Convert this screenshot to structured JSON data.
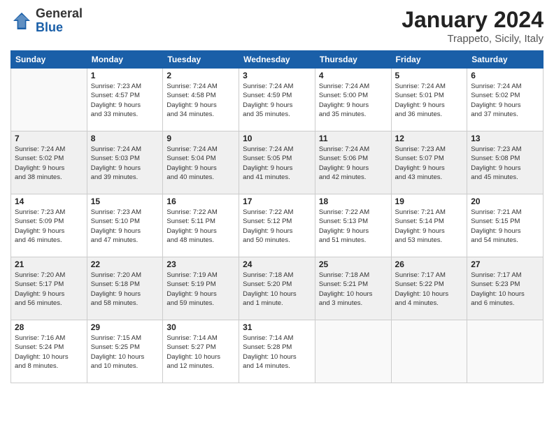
{
  "header": {
    "logo_general": "General",
    "logo_blue": "Blue",
    "title": "January 2024",
    "location": "Trappeto, Sicily, Italy"
  },
  "weekdays": [
    "Sunday",
    "Monday",
    "Tuesday",
    "Wednesday",
    "Thursday",
    "Friday",
    "Saturday"
  ],
  "weeks": [
    [
      {
        "day": "",
        "info": ""
      },
      {
        "day": "1",
        "info": "Sunrise: 7:23 AM\nSunset: 4:57 PM\nDaylight: 9 hours\nand 33 minutes."
      },
      {
        "day": "2",
        "info": "Sunrise: 7:24 AM\nSunset: 4:58 PM\nDaylight: 9 hours\nand 34 minutes."
      },
      {
        "day": "3",
        "info": "Sunrise: 7:24 AM\nSunset: 4:59 PM\nDaylight: 9 hours\nand 35 minutes."
      },
      {
        "day": "4",
        "info": "Sunrise: 7:24 AM\nSunset: 5:00 PM\nDaylight: 9 hours\nand 35 minutes."
      },
      {
        "day": "5",
        "info": "Sunrise: 7:24 AM\nSunset: 5:01 PM\nDaylight: 9 hours\nand 36 minutes."
      },
      {
        "day": "6",
        "info": "Sunrise: 7:24 AM\nSunset: 5:02 PM\nDaylight: 9 hours\nand 37 minutes."
      }
    ],
    [
      {
        "day": "7",
        "info": "Sunrise: 7:24 AM\nSunset: 5:02 PM\nDaylight: 9 hours\nand 38 minutes."
      },
      {
        "day": "8",
        "info": "Sunrise: 7:24 AM\nSunset: 5:03 PM\nDaylight: 9 hours\nand 39 minutes."
      },
      {
        "day": "9",
        "info": "Sunrise: 7:24 AM\nSunset: 5:04 PM\nDaylight: 9 hours\nand 40 minutes."
      },
      {
        "day": "10",
        "info": "Sunrise: 7:24 AM\nSunset: 5:05 PM\nDaylight: 9 hours\nand 41 minutes."
      },
      {
        "day": "11",
        "info": "Sunrise: 7:24 AM\nSunset: 5:06 PM\nDaylight: 9 hours\nand 42 minutes."
      },
      {
        "day": "12",
        "info": "Sunrise: 7:23 AM\nSunset: 5:07 PM\nDaylight: 9 hours\nand 43 minutes."
      },
      {
        "day": "13",
        "info": "Sunrise: 7:23 AM\nSunset: 5:08 PM\nDaylight: 9 hours\nand 45 minutes."
      }
    ],
    [
      {
        "day": "14",
        "info": "Sunrise: 7:23 AM\nSunset: 5:09 PM\nDaylight: 9 hours\nand 46 minutes."
      },
      {
        "day": "15",
        "info": "Sunrise: 7:23 AM\nSunset: 5:10 PM\nDaylight: 9 hours\nand 47 minutes."
      },
      {
        "day": "16",
        "info": "Sunrise: 7:22 AM\nSunset: 5:11 PM\nDaylight: 9 hours\nand 48 minutes."
      },
      {
        "day": "17",
        "info": "Sunrise: 7:22 AM\nSunset: 5:12 PM\nDaylight: 9 hours\nand 50 minutes."
      },
      {
        "day": "18",
        "info": "Sunrise: 7:22 AM\nSunset: 5:13 PM\nDaylight: 9 hours\nand 51 minutes."
      },
      {
        "day": "19",
        "info": "Sunrise: 7:21 AM\nSunset: 5:14 PM\nDaylight: 9 hours\nand 53 minutes."
      },
      {
        "day": "20",
        "info": "Sunrise: 7:21 AM\nSunset: 5:15 PM\nDaylight: 9 hours\nand 54 minutes."
      }
    ],
    [
      {
        "day": "21",
        "info": "Sunrise: 7:20 AM\nSunset: 5:17 PM\nDaylight: 9 hours\nand 56 minutes."
      },
      {
        "day": "22",
        "info": "Sunrise: 7:20 AM\nSunset: 5:18 PM\nDaylight: 9 hours\nand 58 minutes."
      },
      {
        "day": "23",
        "info": "Sunrise: 7:19 AM\nSunset: 5:19 PM\nDaylight: 9 hours\nand 59 minutes."
      },
      {
        "day": "24",
        "info": "Sunrise: 7:18 AM\nSunset: 5:20 PM\nDaylight: 10 hours\nand 1 minute."
      },
      {
        "day": "25",
        "info": "Sunrise: 7:18 AM\nSunset: 5:21 PM\nDaylight: 10 hours\nand 3 minutes."
      },
      {
        "day": "26",
        "info": "Sunrise: 7:17 AM\nSunset: 5:22 PM\nDaylight: 10 hours\nand 4 minutes."
      },
      {
        "day": "27",
        "info": "Sunrise: 7:17 AM\nSunset: 5:23 PM\nDaylight: 10 hours\nand 6 minutes."
      }
    ],
    [
      {
        "day": "28",
        "info": "Sunrise: 7:16 AM\nSunset: 5:24 PM\nDaylight: 10 hours\nand 8 minutes."
      },
      {
        "day": "29",
        "info": "Sunrise: 7:15 AM\nSunset: 5:25 PM\nDaylight: 10 hours\nand 10 minutes."
      },
      {
        "day": "30",
        "info": "Sunrise: 7:14 AM\nSunset: 5:27 PM\nDaylight: 10 hours\nand 12 minutes."
      },
      {
        "day": "31",
        "info": "Sunrise: 7:14 AM\nSunset: 5:28 PM\nDaylight: 10 hours\nand 14 minutes."
      },
      {
        "day": "",
        "info": ""
      },
      {
        "day": "",
        "info": ""
      },
      {
        "day": "",
        "info": ""
      }
    ]
  ]
}
